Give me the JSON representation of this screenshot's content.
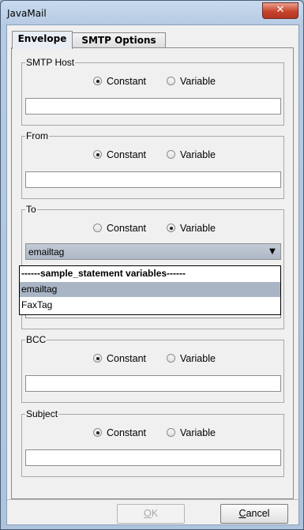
{
  "window": {
    "title": "JavaMail",
    "close_glyph": "✕"
  },
  "tabs": [
    {
      "label": "Envelope",
      "active": true
    },
    {
      "label": "SMTP Options",
      "active": false
    }
  ],
  "groups": [
    {
      "label": "SMTP Host",
      "selected": "Constant",
      "value": ""
    },
    {
      "label": "From",
      "selected": "Constant",
      "value": ""
    },
    {
      "label": "To",
      "selected": "Variable",
      "value": "emailtag"
    },
    {
      "label": "BCC",
      "selected": "Constant",
      "value": ""
    },
    {
      "label": "Subject",
      "selected": "Constant",
      "value": ""
    }
  ],
  "radio_labels": {
    "constant": "Constant",
    "variable": "Variable"
  },
  "dropdown": {
    "header": "------sample_statement variables------",
    "items": [
      "emailtag",
      "FaxTag"
    ],
    "selected": "emailtag"
  },
  "buttons": {
    "ok": {
      "mnemonic": "O",
      "rest": "K",
      "enabled": false
    },
    "cancel": {
      "mnemonic": "C",
      "rest": "ancel",
      "enabled": true
    }
  },
  "icons": {
    "combo_arrow": "dropdown-arrow-icon"
  }
}
